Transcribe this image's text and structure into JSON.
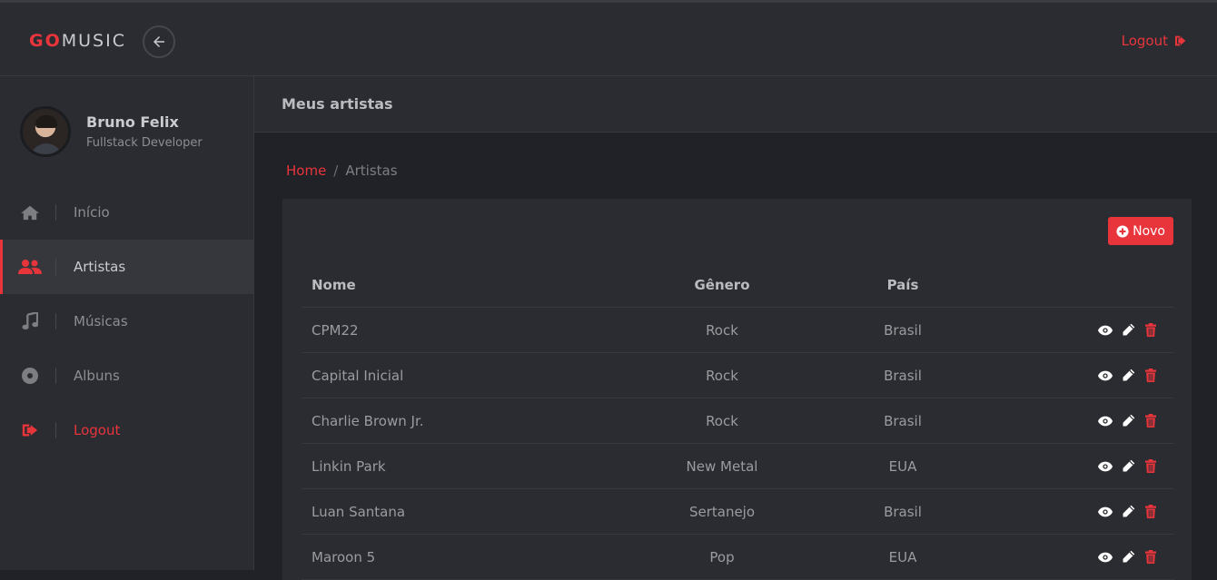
{
  "brand": {
    "part1": "GO",
    "part2": "MUSIC"
  },
  "header": {
    "logout_label": "Logout"
  },
  "profile": {
    "name": "Bruno Felix",
    "role": "Fullstack Developer"
  },
  "sidebar": {
    "items": [
      {
        "label": "Início",
        "icon": "home-icon"
      },
      {
        "label": "Artistas",
        "icon": "users-icon",
        "active": true
      },
      {
        "label": "Músicas",
        "icon": "music-icon"
      },
      {
        "label": "Albuns",
        "icon": "disc-icon"
      },
      {
        "label": "Logout",
        "icon": "logout-icon"
      }
    ]
  },
  "page": {
    "title": "Meus artistas"
  },
  "breadcrumb": {
    "home": "Home",
    "separator": "/",
    "current": "Artistas"
  },
  "actions": {
    "new_label": "Novo"
  },
  "table": {
    "headers": {
      "name": "Nome",
      "genre": "Gênero",
      "country": "País"
    },
    "rows": [
      {
        "name": "CPM22",
        "genre": "Rock",
        "country": "Brasil"
      },
      {
        "name": "Capital Inicial",
        "genre": "Rock",
        "country": "Brasil"
      },
      {
        "name": "Charlie Brown Jr.",
        "genre": "Rock",
        "country": "Brasil"
      },
      {
        "name": "Linkin Park",
        "genre": "New Metal",
        "country": "EUA"
      },
      {
        "name": "Luan Santana",
        "genre": "Sertanejo",
        "country": "Brasil"
      },
      {
        "name": "Maroon 5",
        "genre": "Pop",
        "country": "EUA"
      }
    ]
  },
  "colors": {
    "accent": "#e8353c",
    "background": "#202227",
    "panel": "#2a2c31"
  }
}
